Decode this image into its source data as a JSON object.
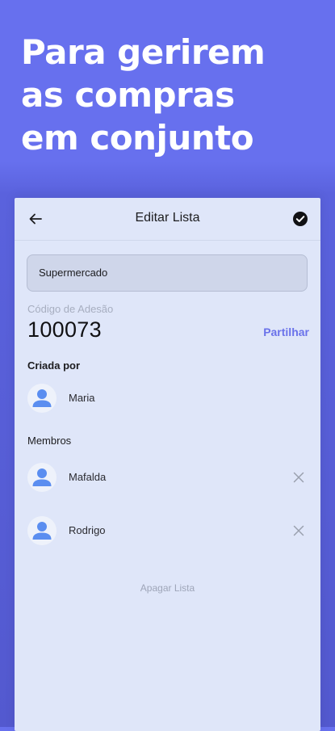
{
  "promo": {
    "line1": "Para gerirem",
    "line2": "as compras",
    "line3": "em conjunto"
  },
  "appbar": {
    "title": "Editar Lista",
    "back_icon": "arrow-left-icon",
    "confirm_icon": "check-circle-icon"
  },
  "list": {
    "name_value": "Supermercado"
  },
  "join_code": {
    "label": "Código de Adesão",
    "value": "100073",
    "share_label": "Partilhar"
  },
  "created_by": {
    "title": "Criada por",
    "name": "Maria"
  },
  "members": {
    "title": "Membros",
    "items": [
      {
        "name": "Mafalda"
      },
      {
        "name": "Rodrigo"
      }
    ]
  },
  "delete_label": "Apagar Lista",
  "colors": {
    "background": "#6770ee",
    "screen": "#dfe6f9",
    "accent": "#6a72ea",
    "avatar": "#5b8ef0"
  }
}
